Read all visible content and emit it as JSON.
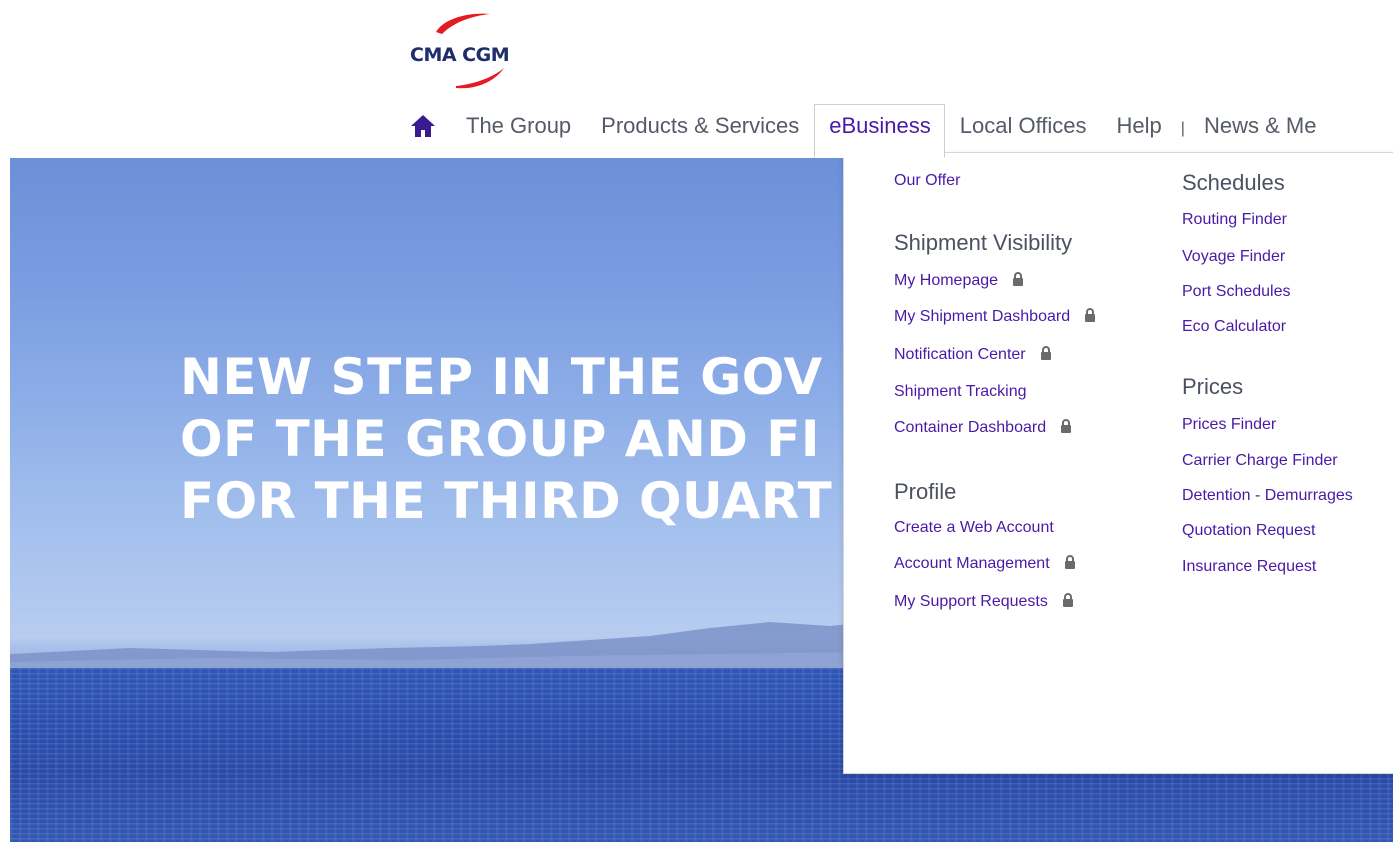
{
  "brand": {
    "logo_text": "CMA CGM",
    "colors": {
      "navy": "#1e2d6b",
      "red": "#e31b23",
      "purple": "#4a1aa6"
    }
  },
  "nav": {
    "home_icon": "home-icon",
    "items": [
      {
        "label": "The Group"
      },
      {
        "label": "Products & Services"
      },
      {
        "label": "eBusiness",
        "active": true
      },
      {
        "label": "Local Offices"
      },
      {
        "label": "Help"
      }
    ],
    "separator": "|",
    "news_label": "News & Me"
  },
  "hero": {
    "headline_lines": [
      "NEW STEP IN THE GOV",
      "OF THE GROUP AND FI",
      "FOR THE THIRD QUART"
    ]
  },
  "menu": {
    "left": {
      "our_offer": "Our Offer",
      "shipment_visibility": {
        "heading": "Shipment Visibility",
        "links": [
          {
            "label": "My Homepage",
            "locked": true
          },
          {
            "label": "My Shipment Dashboard",
            "locked": true
          },
          {
            "label": "Notification Center",
            "locked": true
          },
          {
            "label": "Shipment Tracking",
            "locked": false
          },
          {
            "label": "Container Dashboard",
            "locked": true
          }
        ]
      },
      "profile": {
        "heading": "Profile",
        "links": [
          {
            "label": "Create a Web Account",
            "locked": false
          },
          {
            "label": "Account Management",
            "locked": true
          },
          {
            "label": "My Support Requests",
            "locked": true
          }
        ]
      }
    },
    "right": {
      "schedules": {
        "heading": "Schedules",
        "links": [
          {
            "label": "Routing Finder"
          },
          {
            "label": "Voyage Finder"
          },
          {
            "label": "Port Schedules"
          },
          {
            "label": "Eco Calculator"
          }
        ]
      },
      "prices": {
        "heading": "Prices",
        "links": [
          {
            "label": "Prices Finder"
          },
          {
            "label": "Carrier Charge Finder"
          },
          {
            "label": "Detention - Demurrages"
          },
          {
            "label": "Quotation Request"
          },
          {
            "label": "Insurance Request"
          }
        ]
      }
    }
  }
}
